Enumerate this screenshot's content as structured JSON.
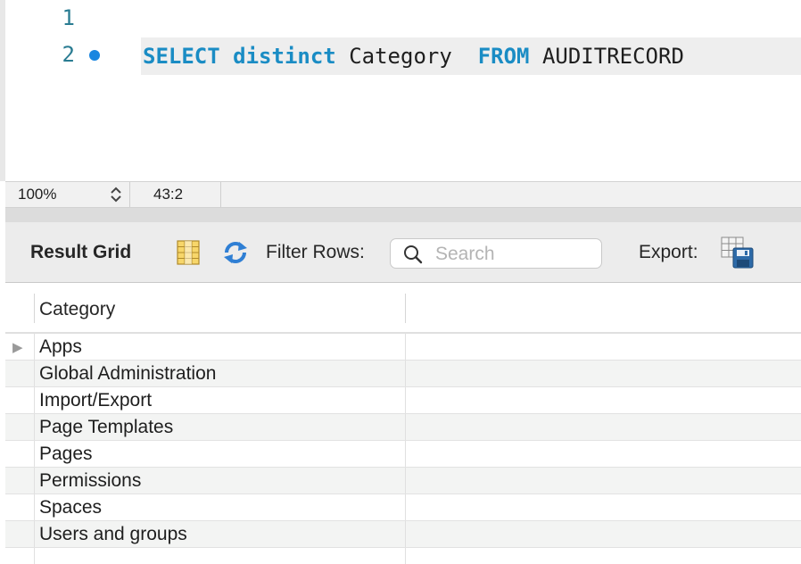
{
  "editor": {
    "line_numbers": [
      "1",
      "2"
    ],
    "sql": {
      "kw_select": "SELECT",
      "kw_distinct": "distinct",
      "column": "Category",
      "kw_from": "FROM",
      "table": "AUDITRECORD"
    },
    "colors": {
      "keyword": "#1a8cc4",
      "line_number": "#2a7c92",
      "breakpoint": "#1a86e0"
    }
  },
  "statusbar": {
    "zoom": "100%",
    "cursor_position": "43:2"
  },
  "toolbar": {
    "result_grid_label": "Result Grid",
    "filter_label": "Filter Rows:",
    "search_placeholder": "Search",
    "search_value": "",
    "export_label": "Export:",
    "icons": [
      "grid-layout-icon",
      "refresh-icon",
      "search-icon",
      "export-icon"
    ]
  },
  "grid": {
    "columns": [
      "Category"
    ],
    "rows": [
      "Apps",
      "Global Administration",
      "Import/Export",
      "Page Templates",
      "Pages",
      "Permissions",
      "Spaces",
      "Users and groups"
    ]
  }
}
